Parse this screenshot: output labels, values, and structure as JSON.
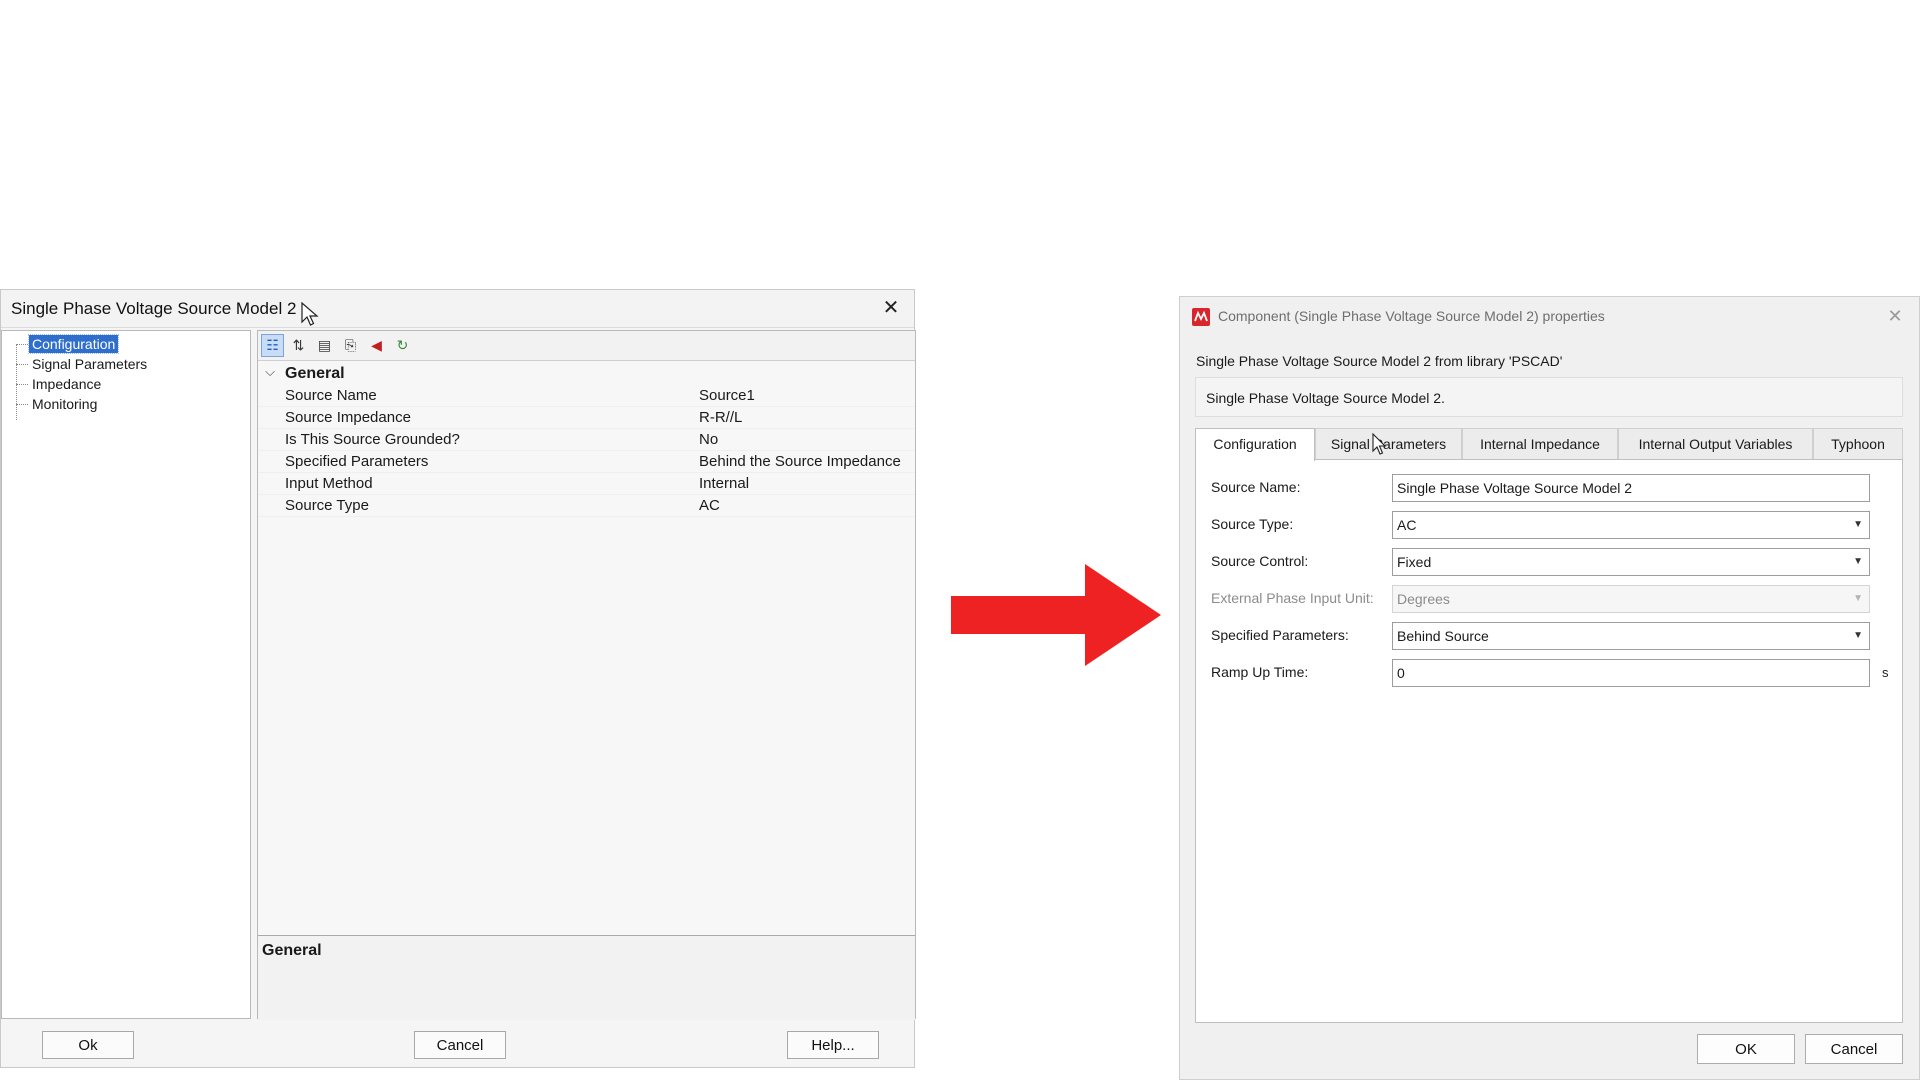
{
  "left_dialog": {
    "title": "Single Phase Voltage Source Model 2",
    "tree": [
      {
        "label": "Configuration",
        "selected": true
      },
      {
        "label": "Signal Parameters",
        "selected": false
      },
      {
        "label": "Impedance",
        "selected": false
      },
      {
        "label": "Monitoring",
        "selected": false
      }
    ],
    "toolbar_icons": [
      "categorized-icon",
      "sort-alphabetical-icon",
      "expand-all-icon",
      "export-icon",
      "import-icon",
      "refresh-icon"
    ],
    "category": "General",
    "properties": [
      {
        "name": "Source Name",
        "value": "Source1"
      },
      {
        "name": "Source Impedance",
        "value": "R-R//L"
      },
      {
        "name": "Is This Source Grounded?",
        "value": "No"
      },
      {
        "name": "Specified Parameters",
        "value": "Behind the Source Impedance"
      },
      {
        "name": "Input Method",
        "value": "Internal"
      },
      {
        "name": "Source Type",
        "value": "AC"
      }
    ],
    "description_title": "General",
    "buttons": {
      "ok": "Ok",
      "cancel": "Cancel",
      "help": "Help..."
    }
  },
  "arrow_color": "#ee2222",
  "right_dialog": {
    "title": "Component (Single Phase Voltage Source Model 2) properties",
    "library_line": "Single Phase Voltage Source Model 2 from library 'PSCAD'",
    "description": "Single Phase Voltage Source Model 2.",
    "tabs": [
      "Configuration",
      "Signal Parameters",
      "Internal Impedance",
      "Internal Output Variables",
      "Typhoon"
    ],
    "active_tab": "Configuration",
    "fields": {
      "source_name": {
        "label": "Source Name:",
        "value": "Single Phase Voltage Source Model 2"
      },
      "source_type": {
        "label": "Source Type:",
        "value": "AC"
      },
      "source_control": {
        "label": "Source Control:",
        "value": "Fixed"
      },
      "ext_phase_unit": {
        "label": "External Phase Input Unit:",
        "value": "Degrees"
      },
      "specified_params": {
        "label": "Specified Parameters:",
        "value": "Behind Source"
      },
      "ramp_up": {
        "label": "Ramp Up Time:",
        "value": "0",
        "unit": "s"
      }
    },
    "buttons": {
      "ok": "OK",
      "cancel": "Cancel"
    },
    "icon_color": "#d9262c"
  }
}
